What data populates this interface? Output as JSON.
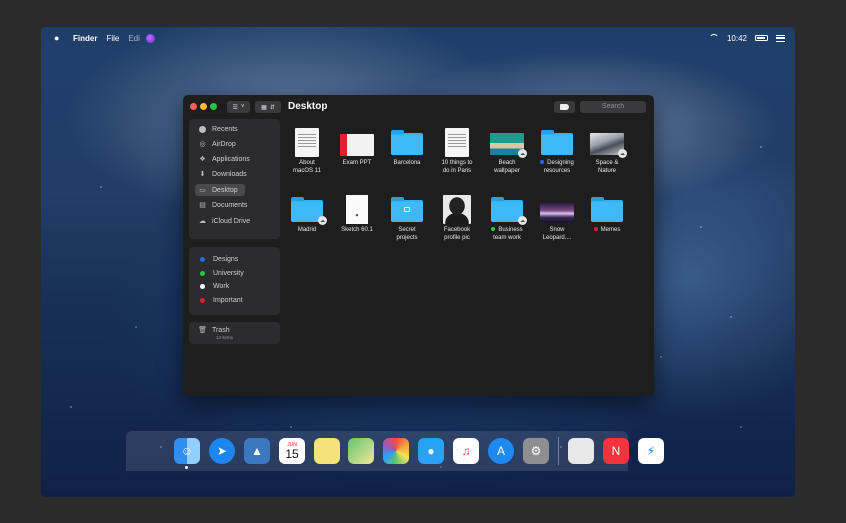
{
  "menubar": {
    "apple_icon": "apple-icon",
    "app_name": "Finder",
    "items": [
      "File",
      "Edi"
    ],
    "time": "10:42"
  },
  "window": {
    "title": "Desktop",
    "search_placeholder": "Search"
  },
  "sidebar": {
    "favorites": [
      {
        "label": "Recents",
        "icon": "clock-icon"
      },
      {
        "label": "AirDrop",
        "icon": "airdrop-icon"
      },
      {
        "label": "Applications",
        "icon": "applications-icon"
      },
      {
        "label": "Downloads",
        "icon": "downloads-icon"
      },
      {
        "label": "Desktop",
        "icon": "desktop-icon",
        "selected": true
      },
      {
        "label": "Documents",
        "icon": "documents-icon"
      },
      {
        "label": "iCloud Drive",
        "icon": "icloud-icon"
      }
    ],
    "tags": [
      {
        "label": "Designs",
        "color": "#1e6bff"
      },
      {
        "label": "University",
        "color": "#28c840"
      },
      {
        "label": "Work",
        "color": "#ffffff"
      },
      {
        "label": "Important",
        "color": "#e0212b"
      }
    ],
    "trash": {
      "label": "Trash",
      "count": "12 items"
    }
  },
  "files": [
    {
      "line1": "About",
      "line2": "macOS 11",
      "kind": "doc"
    },
    {
      "line1": "Exam PPT",
      "line2": "",
      "kind": "ppt"
    },
    {
      "line1": "Barcelona",
      "line2": "",
      "kind": "folder"
    },
    {
      "line1": "10 things to",
      "line2": "do in Paris",
      "kind": "doc"
    },
    {
      "line1": "Beach",
      "line2": "wallpaper",
      "kind": "image-beach",
      "cloud": true
    },
    {
      "line1": "Designing",
      "line2": "resources",
      "kind": "folder",
      "tag": "#1e6bff"
    },
    {
      "line1": "Space &",
      "line2": "Nature",
      "kind": "image-space",
      "cloud": true
    },
    {
      "line1": "Madrid",
      "line2": "",
      "kind": "folder",
      "cloud": true
    },
    {
      "line1": "Sketch 60.1",
      "line2": "",
      "kind": "sketch"
    },
    {
      "line1": "Secret",
      "line2": "projects",
      "kind": "folder-locked"
    },
    {
      "line1": "Facebook",
      "line2": "profile pic",
      "kind": "image-person"
    },
    {
      "line1": "Business",
      "line2": "team work",
      "kind": "folder",
      "tag": "#28c840",
      "cloud": true
    },
    {
      "line1": "Snow",
      "line2": "Leopard....",
      "kind": "image-snow"
    },
    {
      "line1": "Memes",
      "line2": "",
      "kind": "folder",
      "tag": "#e0212b"
    }
  ],
  "dock": [
    {
      "name": "finder-icon",
      "color": "#2f8ef0"
    },
    {
      "name": "safari-icon",
      "color": "#1c86ee"
    },
    {
      "name": "preview-icon",
      "color": "#3b78c0"
    },
    {
      "name": "calendar-icon",
      "color": "#ffffff",
      "month": "JUN",
      "day": "15"
    },
    {
      "name": "notes-icon",
      "color": "#f6e27a"
    },
    {
      "name": "maps-icon",
      "color": "#62c46a"
    },
    {
      "name": "photos-icon",
      "color": "#ffffff"
    },
    {
      "name": "messages-icon",
      "color": "#2aa1f5"
    },
    {
      "name": "music-icon",
      "color": "#ffffff"
    },
    {
      "name": "app-store-icon",
      "color": "#1c8af2"
    },
    {
      "name": "system-preferences-icon",
      "color": "#8e8e93"
    },
    {
      "name": "document-icon",
      "color": "#e8e8e8"
    },
    {
      "name": "news-icon",
      "color": "#f3343f"
    },
    {
      "name": "messenger-icon",
      "color": "#ffffff"
    }
  ]
}
